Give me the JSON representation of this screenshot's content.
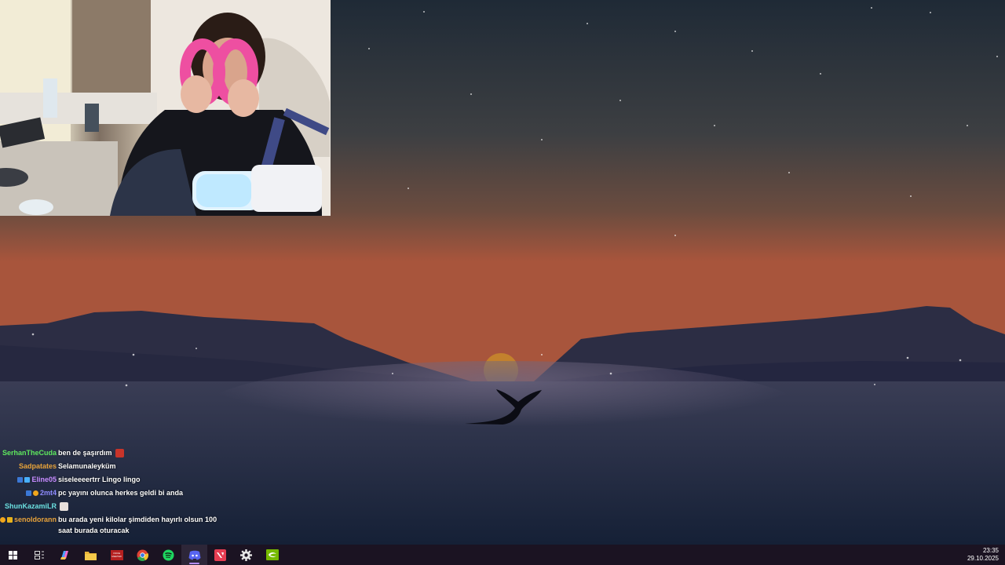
{
  "chat": [
    {
      "user": "SerhanTheCuda",
      "color": "#5ee85e",
      "message": "ben de şaşırdım",
      "badges": [],
      "emote": "angry-emote"
    },
    {
      "user": "Sadpatates",
      "color": "#e8a33a",
      "message": "Selamunaleyküm",
      "badges": [],
      "emote": null
    },
    {
      "user": "Eline05",
      "color": "#c78bff",
      "message": "siseleeeertrr Lingo lingo",
      "badges": [
        "subscriber-badge",
        "gem-badge"
      ],
      "emote": null
    },
    {
      "user": "2mt4",
      "color": "#8f8bff",
      "message": "pc yayını olunca herkes geldi bi anda",
      "badges": [
        "subscriber-badge",
        "bits-badge"
      ],
      "emote": null
    },
    {
      "user": "ShunKazamiLR",
      "color": "#6be0e0",
      "message": "",
      "badges": [],
      "emote": "face-emote"
    },
    {
      "user": "senoldorann",
      "color": "#e8a33a",
      "message": "bu arada yeni kilolar şimdiden hayırlı olsun 100 saat burada oturacak",
      "badges": [
        "bits-badge",
        "crown-badge"
      ],
      "emote": null
    }
  ],
  "taskbar": {
    "icons": [
      {
        "name": "windows-start-icon"
      },
      {
        "name": "task-view-icon"
      },
      {
        "name": "copilot-icon"
      },
      {
        "name": "file-explorer-icon"
      },
      {
        "name": "voicemeeter-icon",
        "label": "VOICE MEETER"
      },
      {
        "name": "chrome-icon"
      },
      {
        "name": "spotify-icon"
      },
      {
        "name": "discord-icon",
        "active": true
      },
      {
        "name": "valorant-icon"
      },
      {
        "name": "settings-gear-icon"
      },
      {
        "name": "nvidia-icon"
      }
    ],
    "time": "23:35",
    "date": "29.10.2025"
  },
  "colors": {
    "taskbar": "#1b1322",
    "active_indicator": "#b58cff",
    "sky_top": "#1f2a36",
    "sky_bottom": "#a8553c"
  }
}
